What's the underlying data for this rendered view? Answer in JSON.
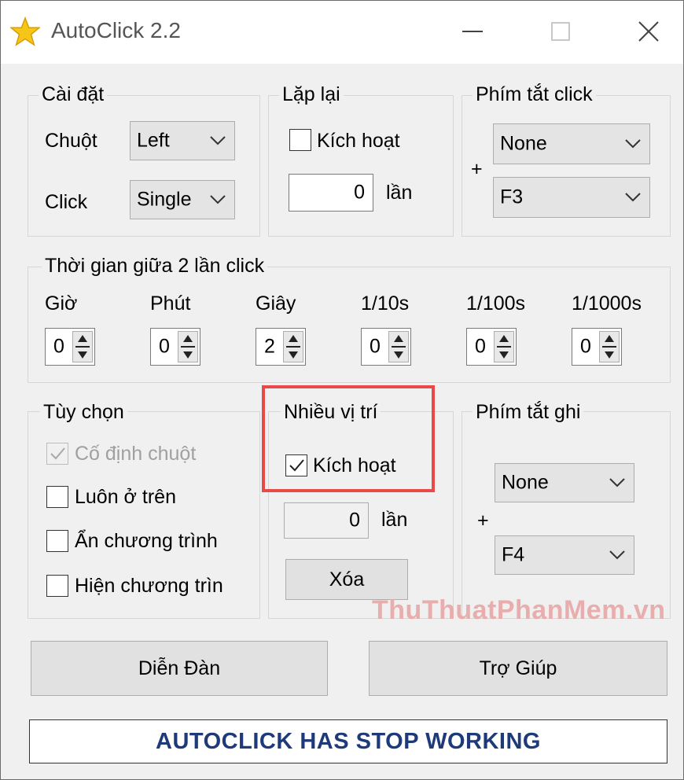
{
  "window": {
    "title": "AutoClick 2.2",
    "icon": "star-icon"
  },
  "settings": {
    "label": "Cài đặt",
    "mouse_label": "Chuột",
    "mouse_value": "Left",
    "click_label": "Click",
    "click_value": "Single"
  },
  "repeat": {
    "label": "Lặp lại",
    "enable_label": "Kích hoạt",
    "count": "0",
    "unit": "lần"
  },
  "click_hotkey": {
    "label": "Phím tắt click",
    "plus": "+",
    "modifier": "None",
    "key": "F3"
  },
  "interval": {
    "label": "Thời gian giữa 2 lần click",
    "fields": [
      {
        "label": "Giờ",
        "value": "0"
      },
      {
        "label": "Phút",
        "value": "0"
      },
      {
        "label": "Giây",
        "value": "2"
      },
      {
        "label": "1/10s",
        "value": "0"
      },
      {
        "label": "1/100s",
        "value": "0"
      },
      {
        "label": "1/1000s",
        "value": "0"
      }
    ]
  },
  "options": {
    "label": "Tùy chọn",
    "items": [
      {
        "label": "Cố định chuột",
        "checked": true,
        "disabled": true
      },
      {
        "label": "Luôn ở trên",
        "checked": false,
        "disabled": false
      },
      {
        "label": "Ẩn chương trình",
        "checked": false,
        "disabled": false
      },
      {
        "label": "Hiện chương trìn",
        "checked": false,
        "disabled": false
      }
    ]
  },
  "multi_position": {
    "label": "Nhiều vị trí",
    "enable_label": "Kích hoạt",
    "checked": true,
    "count": "0",
    "unit": "lần",
    "delete_label": "Xóa"
  },
  "record_hotkey": {
    "label": "Phím tắt ghi",
    "plus": "+",
    "modifier": "None",
    "key": "F4"
  },
  "buttons": {
    "forum": "Diễn Đàn",
    "help": "Trợ Giúp"
  },
  "status": "AUTOCLICK HAS STOP WORKING",
  "watermark": "ThuThuatPhanMem.vn",
  "colors": {
    "highlight": "#e84a4a",
    "status_text": "#1e3a78"
  }
}
